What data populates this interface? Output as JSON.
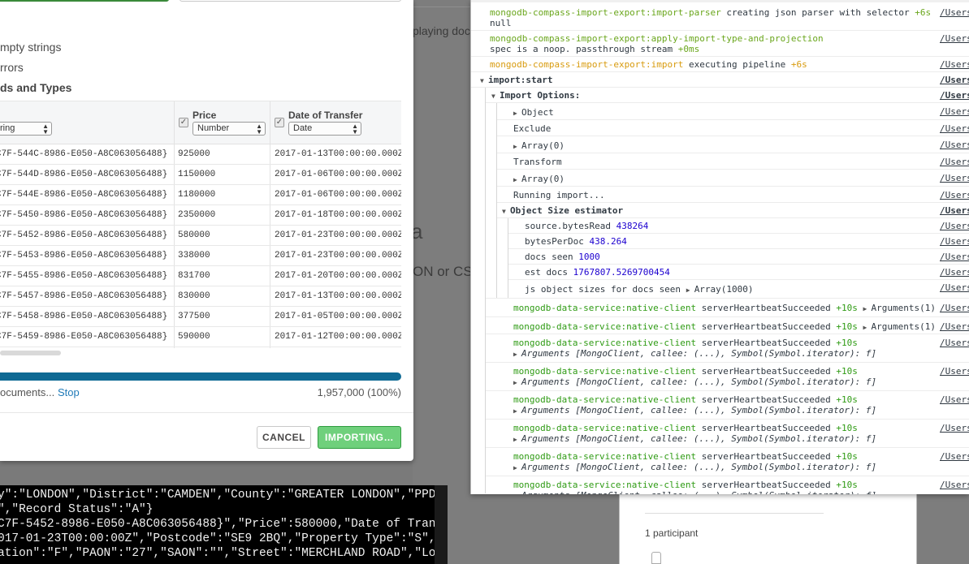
{
  "background": {
    "playing_text": "playing docu",
    "big_letter": "a",
    "on_cs_text": "ON or CS",
    "participant_text": "1 participant"
  },
  "terminal": {
    "lines": [
      "y\":\"LONDON\",\"District\":\"CAMDEN\",\"County\":\"GREATER LONDON\",\"PPD Cat",
      "\",\"Record Status\":\"A\"}",
      "C7F-5452-8986-E050-A8C063056488}\",\"Price\":580000,\"Date of Transfer",
      "017-01-23T00:00:00Z\",\"Postcode\":\"SE9 2BQ\",\"Property Type\":\"S\",\"Old",
      "ation\":\"F\",\"PAON\":\"27\",\"SAON\":\"\",\"Street\":\"MERCHLAND ROAD\",\"Locali"
    ]
  },
  "dialog": {
    "option_empty_strings": "mpty strings",
    "option_errors": "rrors",
    "section_heading": "ds and Types",
    "columns": [
      {
        "label": "",
        "type": "ring",
        "checked": false
      },
      {
        "label": "Price",
        "type": "Number",
        "checked": true
      },
      {
        "label": "Date of Transfer",
        "type": "Date",
        "checked": true
      }
    ],
    "rows": [
      [
        "C7F-544C-8986-E050-A8C063056488}",
        "925000",
        "2017-01-13T00:00:00.000Z"
      ],
      [
        "C7F-544D-8986-E050-A8C063056488}",
        "1150000",
        "2017-01-06T00:00:00.000Z"
      ],
      [
        "C7F-544E-8986-E050-A8C063056488}",
        "1180000",
        "2017-01-06T00:00:00.000Z"
      ],
      [
        "C7F-5450-8986-E050-A8C063056488}",
        "2350000",
        "2017-01-18T00:00:00.000Z"
      ],
      [
        "C7F-5452-8986-E050-A8C063056488}",
        "580000",
        "2017-01-23T00:00:00.000Z"
      ],
      [
        "C7F-5453-8986-E050-A8C063056488}",
        "338000",
        "2017-01-23T00:00:00.000Z"
      ],
      [
        "C7F-5455-8986-E050-A8C063056488}",
        "831700",
        "2017-01-20T00:00:00.000Z"
      ],
      [
        "C7F-5457-8986-E050-A8C063056488}",
        "830000",
        "2017-01-13T00:00:00.000Z"
      ],
      [
        "C7F-5458-8986-E050-A8C063056488}",
        "377500",
        "2017-01-05T00:00:00.000Z"
      ],
      [
        "C7F-5459-8986-E050-A8C063056488}",
        "590000",
        "2017-01-12T00:00:00.000Z"
      ]
    ],
    "progress": {
      "status_text": "ocuments...",
      "stop_label": "Stop",
      "count_text": "1,957,000 (100%)",
      "fraction": 1.0
    },
    "cancel_label": "CANCEL",
    "import_label": "IMPORTING…"
  },
  "console": {
    "entries": [
      {
        "ns": "mongodb-compass-import-export:import-parser",
        "msg": " creating json parser with selector ",
        "time": "+6s"
      },
      {
        "cont": "null"
      },
      {
        "ns": "mongodb-compass-import-export:apply-import-type-and-projection",
        "msg": ""
      },
      {
        "cont": "spec is a noop. passthrough stream ",
        "time": "+0ms"
      },
      {
        "ns": "mongodb-compass-import-export:import",
        "msg": " executing pipeline ",
        "time": "+6s"
      }
    ],
    "group_title": "import:start",
    "import_options_label": "Import Options:",
    "object_label": "Object",
    "exclude_label": "Exclude",
    "array0_label": "Array(0)",
    "transform_label": "Transform",
    "running_label": "Running import...",
    "size_group_label": "Object Size estimator",
    "size_items": [
      {
        "key": "source.bytesRead ",
        "val": "438264"
      },
      {
        "key": "bytesPerDoc ",
        "val": "438.264"
      },
      {
        "key": "docs seen ",
        "val": "1000"
      },
      {
        "key": "est docs ",
        "val": "1767807.5269700454"
      }
    ],
    "js_sizes_key": "js object sizes for docs seen ",
    "js_sizes_val": "Array(1000)",
    "ds_ns": "mongodb-data-service:native-client",
    "ds_msg": " serverHeartbeatSucceeded ",
    "ds_time": "+10s",
    "arguments_short": "Arguments(1)",
    "arguments_long": "Arguments [MongoClient, callee: (...), Symbol(Symbol.iterator): f]",
    "source_link": "/Users"
  }
}
